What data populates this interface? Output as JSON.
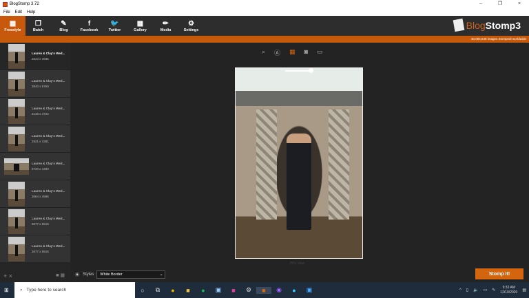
{
  "window": {
    "title": "BlogStomp 3.72",
    "minimize": "–",
    "maximize": "❐",
    "close": "×"
  },
  "menu": [
    "File",
    "Edit",
    "Help"
  ],
  "toolbar": [
    {
      "label": "Freestyle",
      "icon": "▦"
    },
    {
      "label": "Batch",
      "icon": "❐"
    },
    {
      "label": "Blog",
      "icon": "✎"
    },
    {
      "label": "Facebook",
      "icon": "f"
    },
    {
      "label": "Twitter",
      "icon": "🐦"
    },
    {
      "label": "Gallery",
      "icon": "▦"
    },
    {
      "label": "Media",
      "icon": "✏"
    },
    {
      "label": "Settings",
      "icon": "⚙"
    }
  ],
  "brand": {
    "blog": "Blog",
    "stomp": "Stomp3",
    "counter": "30,084,648 images Stomped! worldwide",
    "accent": "#c45a0a"
  },
  "images": [
    {
      "name": "Lauren & Clay's Wed...",
      "size": "2623 x 3935"
    },
    {
      "name": "Lauren & Clay's Wed...",
      "size": "3840 x 5760"
    },
    {
      "name": "Lauren & Clay's Wed...",
      "size": "3148 x 4722"
    },
    {
      "name": "Lauren & Clay's Wed...",
      "size": "2921 x 4381"
    },
    {
      "name": "Lauren & Clay's Wed...",
      "size": "6720 x 4480"
    },
    {
      "name": "Lauren & Clay's Wed...",
      "size": "3064 x 4596"
    },
    {
      "name": "Lauren & Clay's Wed...",
      "size": "3677 x 5515"
    },
    {
      "name": "Lauren & Clay's Wed...",
      "size": "3677 x 5515"
    }
  ],
  "view": {
    "zoom": "25% View"
  },
  "styles": {
    "label": "Styles",
    "value": "White Border"
  },
  "stomp_button": "Stomp It!",
  "taskbar": {
    "search_placeholder": "Type here to search",
    "time": "9:32 AM",
    "date": "12/10/2020"
  }
}
